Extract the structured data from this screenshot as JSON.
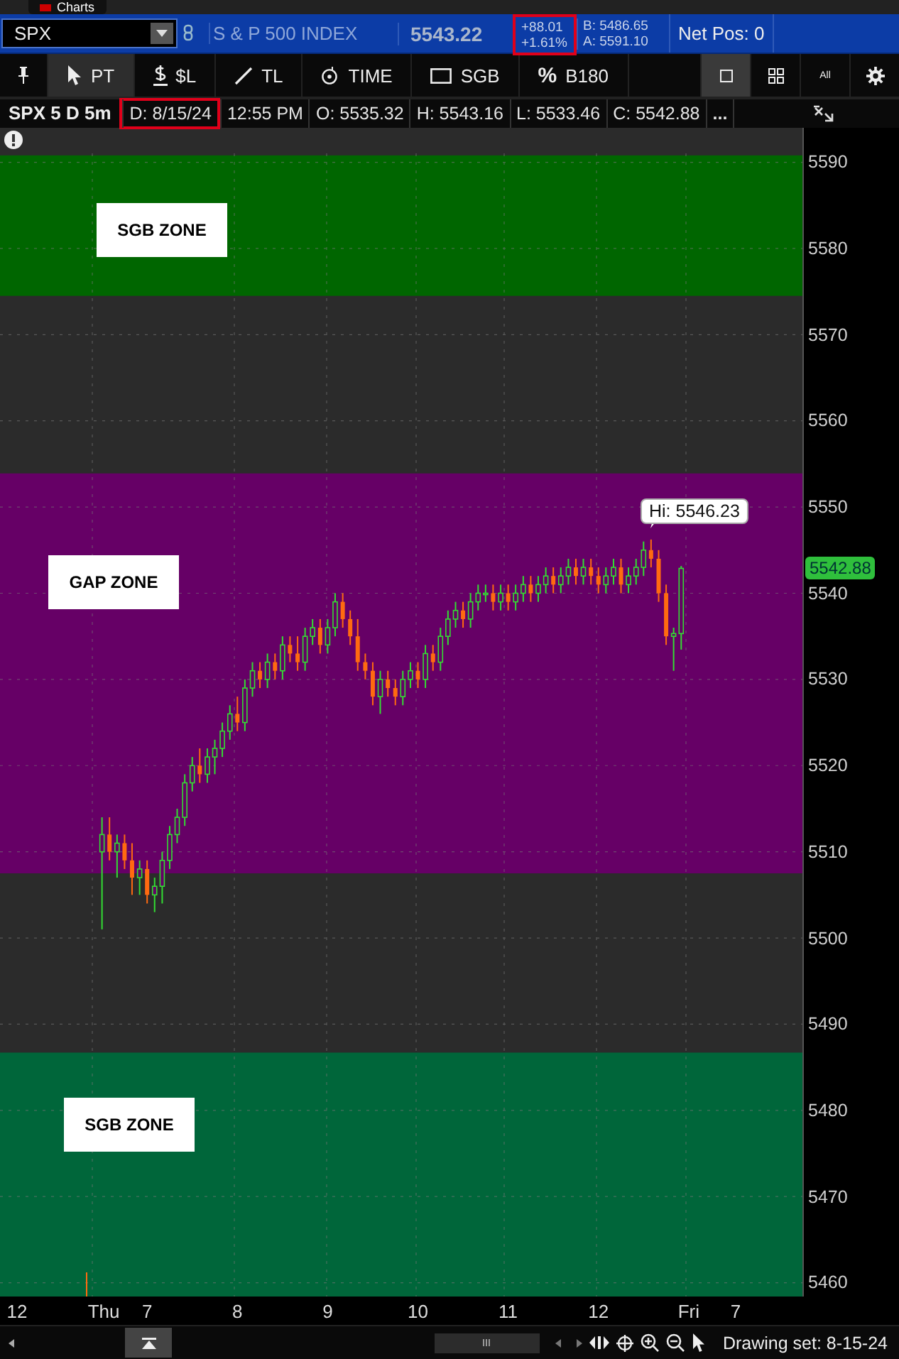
{
  "top_tab": {
    "label": "Charts"
  },
  "quote": {
    "symbol": "SPX",
    "name": "S & P 500 INDEX",
    "last": "5543.22",
    "change": "+88.01",
    "change_pct": "+1.61%",
    "bid": "B: 5486.65",
    "ask": "A: 5591.10",
    "net_pos": "Net Pos: 0"
  },
  "tools": [
    {
      "kind": "pin",
      "selected": false
    },
    {
      "kind": "pointer",
      "label": "PT",
      "selected": true
    },
    {
      "kind": "dollar",
      "label": "$L",
      "selected": false
    },
    {
      "kind": "line",
      "label": "TL",
      "selected": false
    },
    {
      "kind": "time",
      "label": "TIME",
      "selected": false
    },
    {
      "kind": "rect",
      "label": "SGB",
      "selected": false
    },
    {
      "kind": "percent",
      "symbol": "%",
      "label": "B180",
      "selected": false
    }
  ],
  "views": [
    {
      "kind": "single",
      "selected": true
    },
    {
      "kind": "grid",
      "selected": false
    },
    {
      "kind": "all",
      "label": "All",
      "selected": false
    },
    {
      "kind": "settings",
      "selected": false
    }
  ],
  "info": {
    "title": "SPX 5 D 5m",
    "date": "D: 8/15/24",
    "time": "12:55 PM",
    "open": "O: 5535.32",
    "high": "H: 5543.16",
    "low": "L: 5533.46",
    "close": "C: 5542.88",
    "more": "..."
  },
  "chart": {
    "last_price": "5542.88",
    "high_callout": "Hi: 5546.23",
    "outer_time_labels": [
      {
        "label": "12"
      },
      {
        "label": "7"
      }
    ],
    "chart_data": {
      "type": "candlestick",
      "xlim": [
        5.37,
        14.26
      ],
      "ylim": [
        5458.4,
        5594
      ],
      "grid": true,
      "bands": [
        {
          "axis": "y",
          "from": 5574.5,
          "to": 5590.8,
          "label": "SGB ZONE",
          "color": "#006600"
        },
        {
          "axis": "y",
          "from": 5507.5,
          "to": 5553.9,
          "label": "GAP ZONE",
          "color": "#660066"
        },
        {
          "axis": "y",
          "from": 5458.4,
          "to": 5486.7,
          "label": "SGB ZONE",
          "color": "#00663a"
        }
      ],
      "yticks": [
        5590,
        5580,
        5570,
        5560,
        5550,
        5540,
        5530,
        5520,
        5510,
        5500,
        5490,
        5480,
        5470,
        5460
      ],
      "xticks": [
        {
          "value": 6.5,
          "label": "Thu"
        },
        7,
        8,
        9,
        10,
        11,
        12,
        {
          "value": 13,
          "label": "Fri"
        }
      ],
      "x": [
        6.5,
        6.583,
        6.667,
        6.75,
        6.833,
        6.917,
        7,
        7.083,
        7.167,
        7.25,
        7.333,
        7.417,
        7.5,
        7.583,
        7.667,
        7.75,
        7.833,
        7.917,
        8,
        8.083,
        8.167,
        8.25,
        8.333,
        8.417,
        8.5,
        8.583,
        8.667,
        8.75,
        8.833,
        8.917,
        9,
        9.083,
        9.167,
        9.25,
        9.333,
        9.417,
        9.5,
        9.583,
        9.667,
        9.75,
        9.833,
        9.917,
        10,
        10.083,
        10.167,
        10.25,
        10.333,
        10.417,
        10.5,
        10.583,
        10.667,
        10.75,
        10.833,
        10.917,
        11,
        11.083,
        11.167,
        11.25,
        11.333,
        11.417,
        11.5,
        11.583,
        11.667,
        11.75,
        11.833,
        11.917,
        12,
        12.083,
        12.167,
        12.25,
        12.333,
        12.417,
        12.5,
        12.583,
        12.667,
        12.75,
        12.833,
        12.917
      ],
      "ohlc": [
        [
          5510,
          5514,
          5501,
          5512
        ],
        [
          5512,
          5514,
          5509,
          5510
        ],
        [
          5510,
          5512,
          5507,
          5511
        ],
        [
          5511,
          5512,
          5508,
          5509
        ],
        [
          5509,
          5511,
          5505,
          5507
        ],
        [
          5507,
          5509,
          5505,
          5508
        ],
        [
          5508,
          5509,
          5504,
          5505
        ],
        [
          5505,
          5507,
          5503,
          5506
        ],
        [
          5506,
          5510,
          5504,
          5509
        ],
        [
          5509,
          5513,
          5508,
          5512
        ],
        [
          5512,
          5515,
          5511,
          5514
        ],
        [
          5514,
          5519,
          5513,
          5518
        ],
        [
          5518,
          5521,
          5517,
          5520
        ],
        [
          5520,
          5522,
          5518,
          5519
        ],
        [
          5519,
          5522,
          5518,
          5521
        ],
        [
          5521,
          5523,
          5519,
          5522
        ],
        [
          5522,
          5525,
          5521,
          5524
        ],
        [
          5524,
          5527,
          5523,
          5526
        ],
        [
          5526,
          5528,
          5524,
          5525
        ],
        [
          5525,
          5530,
          5524,
          5529
        ],
        [
          5529,
          5532,
          5528,
          5531
        ],
        [
          5531,
          5532,
          5529,
          5530
        ],
        [
          5530,
          5533,
          5529,
          5532
        ],
        [
          5532,
          5533,
          5530,
          5531
        ],
        [
          5531,
          5535,
          5530,
          5534
        ],
        [
          5534,
          5535,
          5532,
          5533
        ],
        [
          5533,
          5535,
          5531,
          5532
        ],
        [
          5532,
          5536,
          5531,
          5535
        ],
        [
          5535,
          5537,
          5534,
          5536
        ],
        [
          5536,
          5537,
          5533,
          5534
        ],
        [
          5534,
          5537,
          5533,
          5536
        ],
        [
          5536,
          5540,
          5535,
          5539
        ],
        [
          5539,
          5540,
          5536,
          5537
        ],
        [
          5537,
          5538,
          5534,
          5535
        ],
        [
          5535,
          5537,
          5531,
          5532
        ],
        [
          5532,
          5533,
          5530,
          5531
        ],
        [
          5531,
          5532,
          5527,
          5528
        ],
        [
          5528,
          5531,
          5526,
          5530
        ],
        [
          5530,
          5531,
          5528,
          5529
        ],
        [
          5529,
          5530,
          5527,
          5528
        ],
        [
          5528,
          5531,
          5527,
          5530
        ],
        [
          5530,
          5532,
          5529,
          5531
        ],
        [
          5531,
          5532,
          5529,
          5530
        ],
        [
          5530,
          5534,
          5529,
          5533
        ],
        [
          5533,
          5534,
          5531,
          5532
        ],
        [
          5532,
          5536,
          5531,
          5535
        ],
        [
          5535,
          5538,
          5534,
          5537
        ],
        [
          5537,
          5539,
          5536,
          5538
        ],
        [
          5538,
          5539,
          5536,
          5537
        ],
        [
          5537,
          5540,
          5536,
          5539
        ],
        [
          5539,
          5541,
          5538,
          5540
        ],
        [
          5540,
          5541,
          5539,
          5540
        ],
        [
          5540,
          5541,
          5538,
          5539
        ],
        [
          5539,
          5541,
          5538,
          5540
        ],
        [
          5540,
          5541,
          5538,
          5539
        ],
        [
          5539,
          5541,
          5538,
          5540
        ],
        [
          5540,
          5542,
          5539,
          5541
        ],
        [
          5541,
          5542,
          5539,
          5540
        ],
        [
          5540,
          5542,
          5539,
          5541
        ],
        [
          5541,
          5543,
          5540,
          5542
        ],
        [
          5542,
          5543,
          5540,
          5541
        ],
        [
          5541,
          5543,
          5540,
          5542
        ],
        [
          5542,
          5544,
          5541,
          5543
        ],
        [
          5543,
          5544,
          5541,
          5542
        ],
        [
          5542,
          5544,
          5541,
          5543
        ],
        [
          5543,
          5544,
          5541,
          5542
        ],
        [
          5542,
          5543,
          5540,
          5541
        ],
        [
          5541,
          5543,
          5540,
          5542
        ],
        [
          5542,
          5544,
          5541,
          5543
        ],
        [
          5543,
          5544,
          5540,
          5541
        ],
        [
          5541,
          5543,
          5540,
          5542
        ],
        [
          5542,
          5544,
          5541,
          5543
        ],
        [
          5543,
          5546,
          5542,
          5545
        ],
        [
          5545,
          5546.23,
          5543,
          5544
        ],
        [
          5544,
          5545,
          5539,
          5540
        ],
        [
          5540,
          5541,
          5534,
          5535
        ],
        [
          5535,
          5536,
          5531,
          5535.32
        ],
        [
          5535.32,
          5543.16,
          5533.46,
          5542.88
        ]
      ]
    }
  },
  "drawing_set": "Drawing set: 8-15-24"
}
